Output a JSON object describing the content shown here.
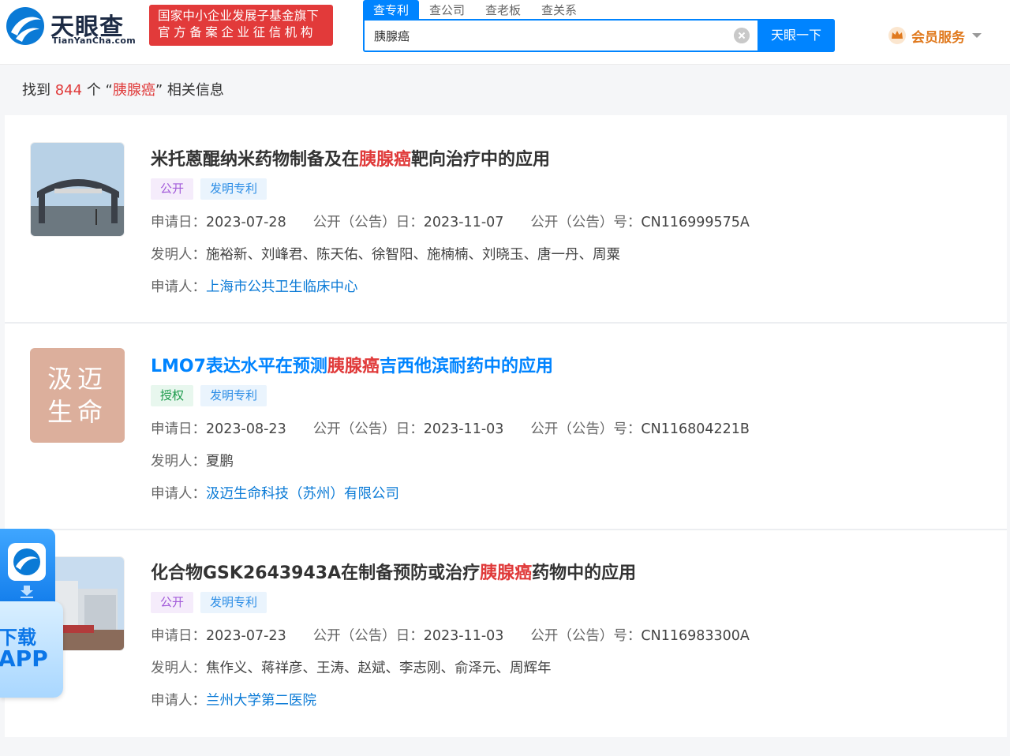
{
  "header": {
    "logo_title": "天眼查",
    "logo_sub": "TianYanCha.com",
    "badge_line1": "国家中小企业发展子基金旗下",
    "badge_line2": "官方备案企业征信机构",
    "search_tabs": [
      "查专利",
      "查公司",
      "查老板",
      "查关系"
    ],
    "search_value": "胰腺癌",
    "search_button": "天眼一下",
    "member_label": "会员服务"
  },
  "summary": {
    "prefix": "找到",
    "count": "844",
    "mid": "个 “",
    "keyword": "胰腺癌",
    "suffix": "” 相关信息"
  },
  "results": [
    {
      "title_pre": "米托蒽醌纳米药物制备及在",
      "title_hl": "胰腺癌",
      "title_post": "靶向治疗中的应用",
      "tags": [
        "公开",
        "发明专利"
      ],
      "apply_label": "申请日：",
      "apply_date": "2023-07-28",
      "pub_label": "公开（公告）日：",
      "pub_date": "2023-11-07",
      "pubno_label": "公开（公告）号：",
      "pub_no": "CN116999575A",
      "inventor_label": "发明人：",
      "inventors": "施裕新、刘峰君、陈天佑、徐智阳、施楠楠、刘晓玉、唐一丹、周粟",
      "applicant_label": "申请人：",
      "applicant": "上海市公共卫生临床中心"
    },
    {
      "title_pre": "LMO7表达水平在预测",
      "title_hl": "胰腺癌",
      "title_post": "吉西他滨耐药中的应用",
      "logo_text_1": "汲迈",
      "logo_text_2": "生命",
      "tags": [
        "授权",
        "发明专利"
      ],
      "apply_label": "申请日：",
      "apply_date": "2023-08-23",
      "pub_label": "公开（公告）日：",
      "pub_date": "2023-11-03",
      "pubno_label": "公开（公告）号：",
      "pub_no": "CN116804221B",
      "inventor_label": "发明人：",
      "inventors": "夏鹏",
      "applicant_label": "申请人：",
      "applicant": "汲迈生命科技（苏州）有限公司"
    },
    {
      "title_pre": "化合物GSK2643943A在制备预防或治疗",
      "title_hl": "胰腺癌",
      "title_post": "药物中的应用",
      "tags": [
        "公开",
        "发明专利"
      ],
      "apply_label": "申请日：",
      "apply_date": "2023-07-23",
      "pub_label": "公开（公告）日：",
      "pub_date": "2023-11-03",
      "pubno_label": "公开（公告）号：",
      "pub_no": "CN116983300A",
      "inventor_label": "发明人：",
      "inventors": "焦作义、蒋祥彦、王涛、赵斌、李志刚、俞泽元、周辉年",
      "applicant_label": "申请人：",
      "applicant": "兰州大学第二医院"
    }
  ],
  "float": {
    "line1": "下载",
    "line2": "APP"
  },
  "colors": {
    "brand_blue": "#0084ff",
    "highlight_red": "#e03a3a",
    "badge_red": "#e23a3a",
    "member_orange": "#e07a1f"
  }
}
